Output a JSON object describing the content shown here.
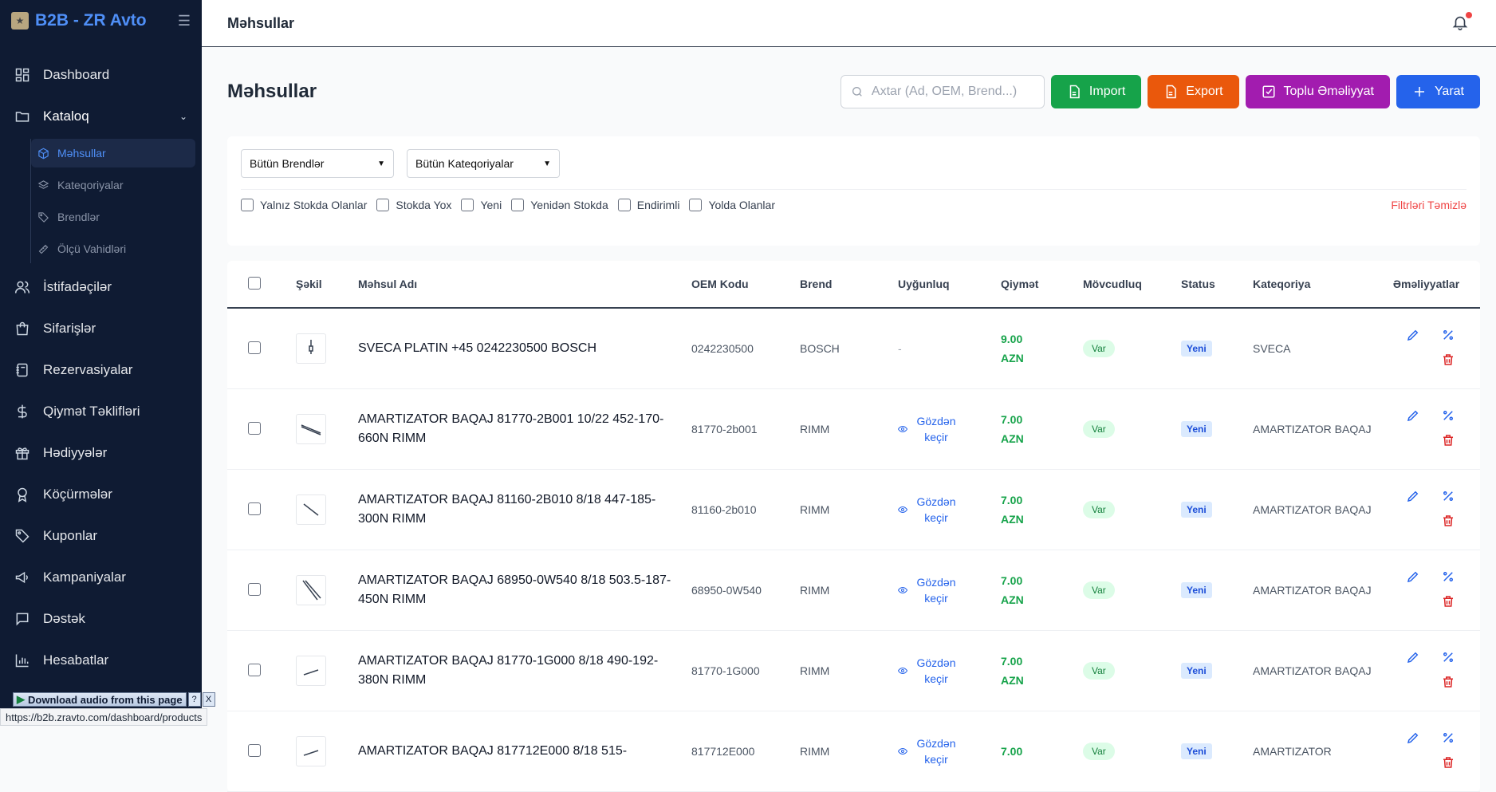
{
  "brand": {
    "title": "B2B - ZR Avto",
    "logo_icon": "logo-icon",
    "menu_icon": "hamburger-icon"
  },
  "nav": {
    "items": [
      {
        "label": "Dashboard",
        "icon": "dashboard-icon"
      },
      {
        "label": "Kataloq",
        "icon": "folder-icon"
      },
      {
        "label": "İstifadəçilər",
        "icon": "users-icon"
      },
      {
        "label": "Sifarişlər",
        "icon": "bag-icon"
      },
      {
        "label": "Rezervasiyalar",
        "icon": "notebook-icon"
      },
      {
        "label": "Qiymət Təklifləri",
        "icon": "dollar-icon"
      },
      {
        "label": "Hədiyyələr",
        "icon": "gift-icon"
      },
      {
        "label": "Köçürmələr",
        "icon": "award-icon"
      },
      {
        "label": "Kuponlar",
        "icon": "tag-icon"
      },
      {
        "label": "Kampaniyalar",
        "icon": "megaphone-icon"
      },
      {
        "label": "Dəstək",
        "icon": "chat-icon"
      },
      {
        "label": "Hesabatlar",
        "icon": "chart-icon"
      }
    ],
    "catalog_sub": [
      {
        "label": "Məhsullar",
        "icon": "box-icon"
      },
      {
        "label": "Kateqoriyalar",
        "icon": "layers-icon"
      },
      {
        "label": "Brendlər",
        "icon": "tag-icon"
      },
      {
        "label": "Ölçü Vahidləri",
        "icon": "ruler-icon"
      }
    ]
  },
  "topbar": {
    "title": "Məhsullar"
  },
  "page": {
    "title": "Məhsullar",
    "search_placeholder": "Axtar (Ad, OEM, Brend...)",
    "buttons": {
      "import": "Import",
      "export": "Export",
      "bulk": "Toplu Əməliyyat",
      "create": "Yarat"
    },
    "colors": {
      "import": "#16a34a",
      "export": "#ea580c",
      "bulk": "#a21caf",
      "create": "#2563eb"
    }
  },
  "filters": {
    "brand_select": "Bütün Brendlər",
    "category_select": "Bütün Kateqoriyalar",
    "checks": [
      "Yalnız Stokda Olanlar",
      "Stokda Yox",
      "Yeni",
      "Yenidən Stokda",
      "Endirimli",
      "Yolda Olanlar"
    ],
    "clear": "Filtrləri Təmizlə"
  },
  "table": {
    "headers": {
      "image": "Şəkil",
      "name": "Məhsul Adı",
      "oem": "OEM Kodu",
      "brand": "Brend",
      "fit": "Uyğunluq",
      "price": "Qiymət",
      "stock": "Mövcudluq",
      "status": "Status",
      "category": "Kateqoriya",
      "actions": "Əməliyyatlar"
    },
    "view_label": "Gözdən keçir",
    "rows": [
      {
        "name": "SVECA PLATIN +45 0242230500 BOSCH",
        "oem": "0242230500",
        "brand": "BOSCH",
        "fit": "-",
        "price": "9.00 AZN",
        "stock": "Var",
        "status": "Yeni",
        "category": "SVECA"
      },
      {
        "name": "AMARTIZATOR BAQAJ 81770-2B001 10/22 452-170-660N RIMM",
        "oem": "81770-2b001",
        "brand": "RIMM",
        "fit": "Gözdən keçir",
        "price": "7.00 AZN",
        "stock": "Var",
        "status": "Yeni",
        "category": "AMARTIZATOR BAQAJ"
      },
      {
        "name": "AMARTIZATOR BAQAJ 81160-2B010 8/18 447-185-300N RIMM",
        "oem": "81160-2b010",
        "brand": "RIMM",
        "fit": "Gözdən keçir",
        "price": "7.00 AZN",
        "stock": "Var",
        "status": "Yeni",
        "category": "AMARTIZATOR BAQAJ"
      },
      {
        "name": "AMARTIZATOR BAQAJ 68950-0W540 8/18 503.5-187-450N RIMM",
        "oem": "68950-0W540",
        "brand": "RIMM",
        "fit": "Gözdən keçir",
        "price": "7.00 AZN",
        "stock": "Var",
        "status": "Yeni",
        "category": "AMARTIZATOR BAQAJ"
      },
      {
        "name": "AMARTIZATOR BAQAJ 81770-1G000 8/18 490-192-380N RIMM",
        "oem": "81770-1G000",
        "brand": "RIMM",
        "fit": "Gözdən keçir",
        "price": "7.00 AZN",
        "stock": "Var",
        "status": "Yeni",
        "category": "AMARTIZATOR BAQAJ"
      },
      {
        "name": "AMARTIZATOR BAQAJ 817712E000 8/18 515-",
        "oem": "817712E000",
        "brand": "RIMM",
        "fit": "Gözdən keçir",
        "price": "7.00",
        "stock": "Var",
        "status": "Yeni",
        "category": "AMARTIZATOR"
      }
    ]
  },
  "overlay": {
    "download": "Download audio from this page",
    "help": "?",
    "close": "X"
  },
  "statusbar": {
    "url": "https://b2b.zravto.com/dashboard/products"
  }
}
